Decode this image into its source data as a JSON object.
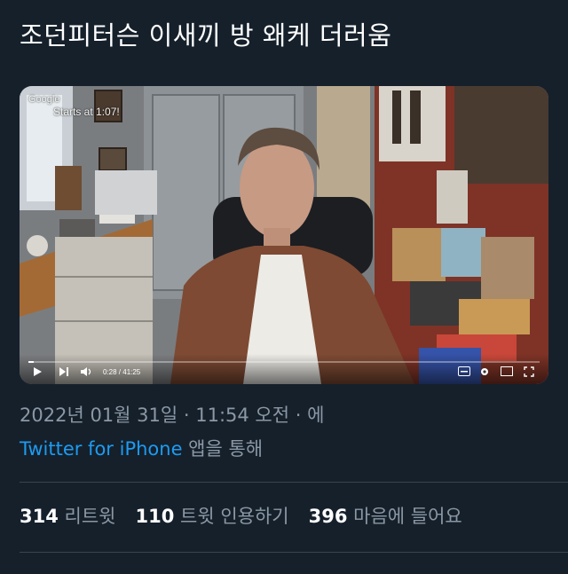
{
  "tweet": {
    "text": "조던피터슨 이새끼 방 왜케 더러움"
  },
  "video": {
    "watermark_brand": "Google",
    "watermark_text": "Starts at 1:07!",
    "time": "0:28 / 41:25",
    "progress_fraction": 0.011
  },
  "meta": {
    "date": "2022년 01월 31일",
    "sep1": " · ",
    "time": "11:54 오전",
    "sep2": " · 에"
  },
  "source": {
    "app": "Twitter for iPhone",
    "suffix": " 앱을 통해"
  },
  "stats": {
    "retweets_count": "314",
    "retweets_label": " 리트윗",
    "quotes_count": "110",
    "quotes_label": " 트윗 인용하기",
    "likes_count": "396",
    "likes_label": " 마음에 들어요"
  },
  "colors": {
    "background": "#15202b",
    "link": "#1d9bf0",
    "secondary_text": "#8b98a5"
  }
}
